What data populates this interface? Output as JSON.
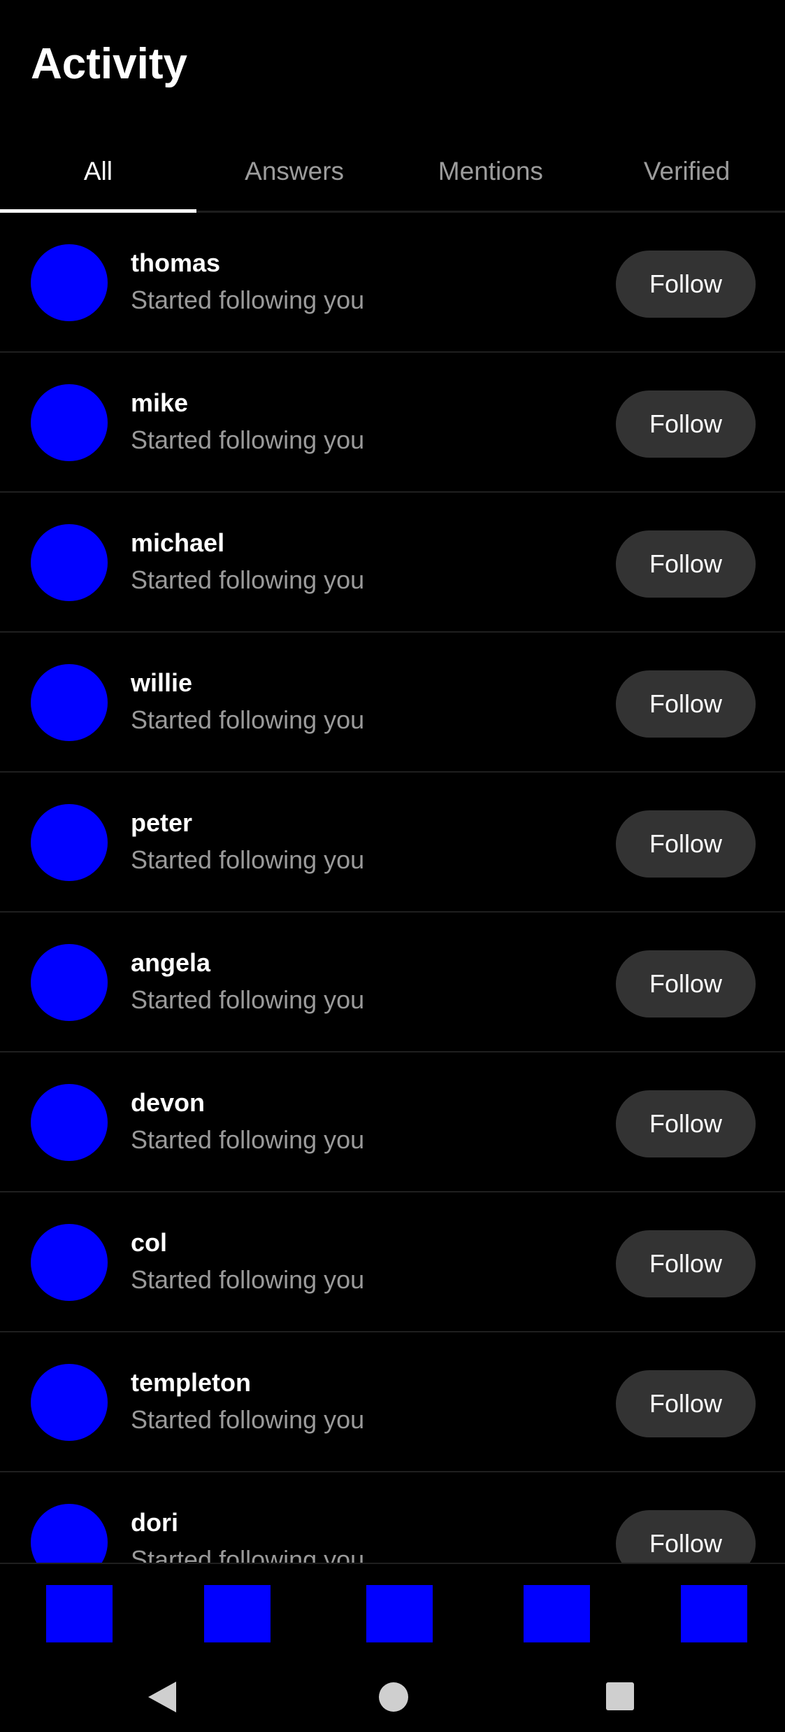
{
  "header": {
    "title": "Activity"
  },
  "tabs": [
    {
      "label": "All",
      "active": true
    },
    {
      "label": "Answers",
      "active": false
    },
    {
      "label": "Mentions",
      "active": false
    },
    {
      "label": "Verified",
      "active": false
    }
  ],
  "activity": {
    "avatar_color": "#0000ff",
    "items": [
      {
        "username": "thomas",
        "text": "Started following you",
        "button": "Follow"
      },
      {
        "username": "mike",
        "text": "Started following you",
        "button": "Follow"
      },
      {
        "username": "michael",
        "text": "Started following you",
        "button": "Follow"
      },
      {
        "username": "willie",
        "text": "Started following you",
        "button": "Follow"
      },
      {
        "username": "peter",
        "text": "Started following you",
        "button": "Follow"
      },
      {
        "username": "angela",
        "text": "Started following you",
        "button": "Follow"
      },
      {
        "username": "devon",
        "text": "Started following you",
        "button": "Follow"
      },
      {
        "username": "col",
        "text": "Started following you",
        "button": "Follow"
      },
      {
        "username": "templeton",
        "text": "Started following you",
        "button": "Follow"
      },
      {
        "username": "dori",
        "text": "Started following you",
        "button": "Follow"
      }
    ]
  },
  "bottom_nav": {
    "item_color": "#0000ff",
    "items": [
      "nav-item-1",
      "nav-item-2",
      "nav-item-3",
      "nav-item-4",
      "nav-item-5"
    ]
  },
  "system_nav": {
    "icons": [
      "back-icon",
      "home-icon",
      "recents-icon"
    ]
  }
}
